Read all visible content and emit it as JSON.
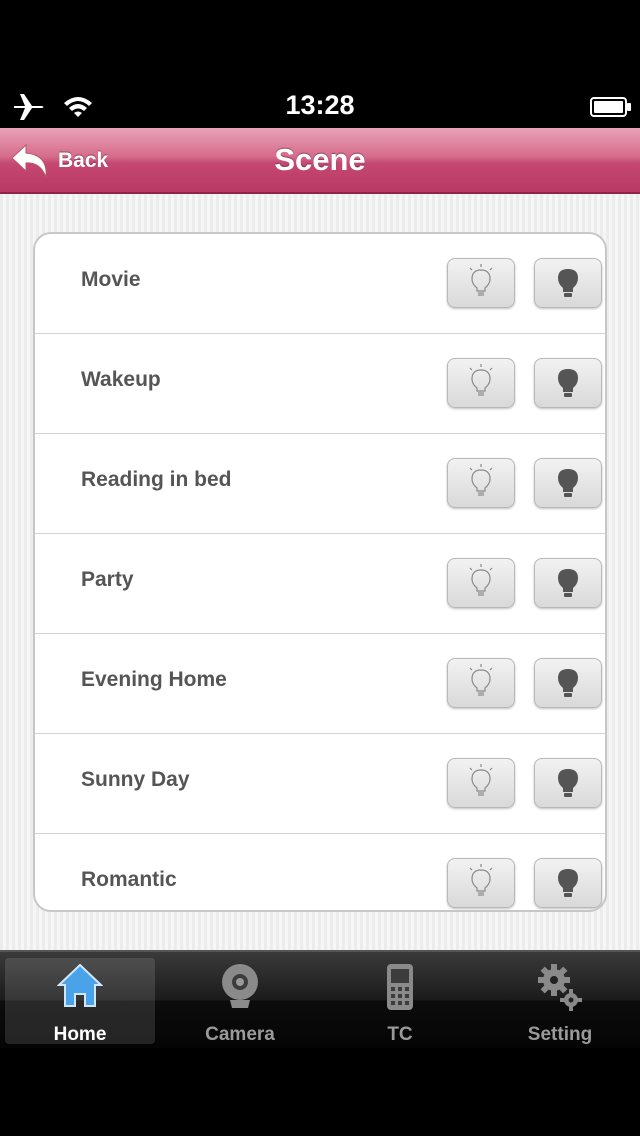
{
  "status": {
    "time": "13:28",
    "icons": [
      "airplane-icon",
      "wifi-icon",
      "battery-icon"
    ]
  },
  "nav": {
    "title": "Scene",
    "back_label": "Back"
  },
  "scenes": [
    {
      "name": "Movie"
    },
    {
      "name": "Wakeup"
    },
    {
      "name": "Reading in bed"
    },
    {
      "name": "Party"
    },
    {
      "name": "Evening Home"
    },
    {
      "name": "Sunny Day"
    },
    {
      "name": "Romantic"
    }
  ],
  "tabs": [
    {
      "label": "Home",
      "icon": "home-icon",
      "selected": true
    },
    {
      "label": "Camera",
      "icon": "camera-icon",
      "selected": false
    },
    {
      "label": "TC",
      "icon": "phone-icon",
      "selected": false
    },
    {
      "label": "Setting",
      "icon": "gear-icon",
      "selected": false
    }
  ],
  "colors": {
    "nav_accent": "#c54872",
    "tab_selected": "#4aa3e8"
  }
}
